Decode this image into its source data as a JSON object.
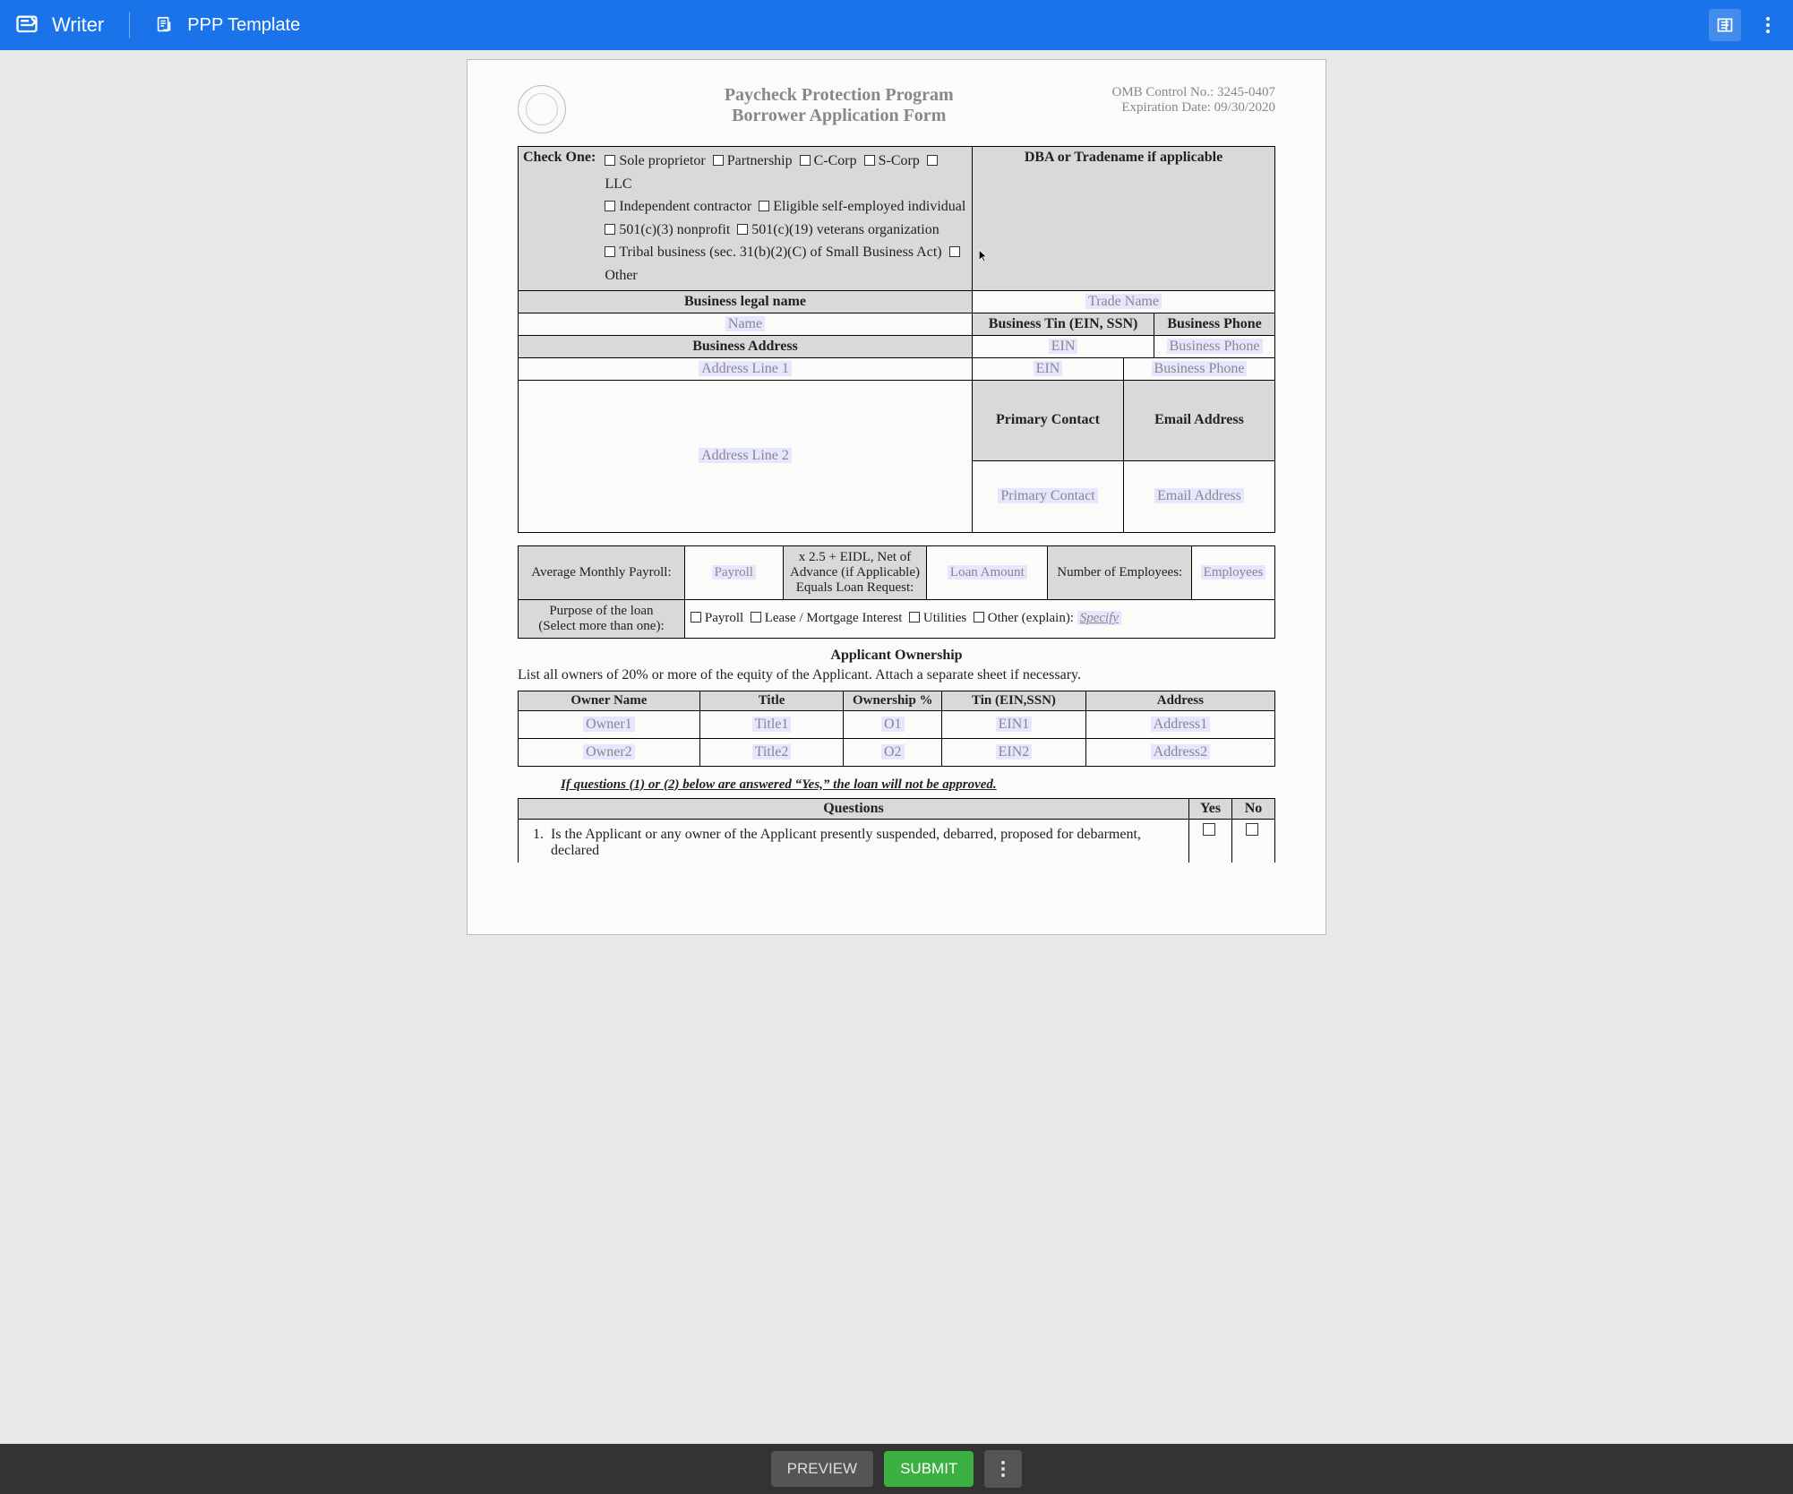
{
  "topbar": {
    "app_name": "Writer",
    "template_name": "PPP Template"
  },
  "doc": {
    "title1": "Paycheck Protection Program",
    "title2": "Borrower Application Form",
    "omb": "OMB Control No.: 3245-0407",
    "expiry": "Expiration Date: 09/30/2020",
    "check_one_label": "Check One:",
    "entity_types": [
      "Sole proprietor",
      "Partnership",
      "C-Corp",
      "S-Corp",
      "LLC",
      "Independent contractor",
      "Eligible self-employed individual",
      "501(c)(3) nonprofit",
      "501(c)(19) veterans organization",
      "Tribal business (sec. 31(b)(2)(C) of Small Business Act)",
      "Other"
    ],
    "dba_header": "DBA or Tradename if applicable",
    "legal_name_header": "Business legal name",
    "name_ph": "Name",
    "trade_ph": "Trade Name",
    "addr_header": "Business Address",
    "tin_header": "Business Tin (EIN, SSN)",
    "phone_header": "Business Phone",
    "addr1_ph": "Address Line 1",
    "ein_ph": "EIN",
    "phone_ph": "Business Phone",
    "addr2_ph": "Address Line 2",
    "contact_header": "Primary Contact",
    "email_header": "Email Address",
    "contact_ph": "Primary Contact",
    "email_ph": "Email Address",
    "avg_payroll_label": "Average Monthly Payroll:",
    "payroll_ph": "Payroll",
    "multiplier_text": "x 2.5 + EIDL, Net of Advance (if Applicable) Equals Loan Request:",
    "loan_ph": "Loan Amount",
    "num_emp_label": "Number of Employees:",
    "emp_ph": "Employees",
    "purpose_label1": "Purpose of the loan",
    "purpose_label2": "(Select more than one):",
    "purpose_opts": [
      "Payroll",
      "Lease / Mortgage Interest",
      "Utilities"
    ],
    "purpose_other": "Other (explain):",
    "specify_ph": "Specify",
    "ownership_title": "Applicant Ownership",
    "ownership_desc": "List all owners of 20% or more of the equity of the Applicant. Attach a separate sheet if necessary.",
    "owner_cols": [
      "Owner Name",
      "Title",
      "Ownership %",
      "Tin (EIN,SSN)",
      "Address"
    ],
    "owner_rows": [
      [
        "Owner1",
        "Title1",
        "O1",
        "EIN1",
        "Address1"
      ],
      [
        "Owner2",
        "Title2",
        "O2",
        "EIN2",
        "Address2"
      ]
    ],
    "warning": "If questions (1) or (2) below are answered “Yes,” the loan will not be approved.",
    "q_header": "Questions",
    "yes": "Yes",
    "no": "No",
    "q1": "Is the Applicant or any owner of the Applicant presently suspended, debarred, proposed for debarment, declared"
  },
  "bottombar": {
    "preview": "PREVIEW",
    "submit": "SUBMIT"
  }
}
